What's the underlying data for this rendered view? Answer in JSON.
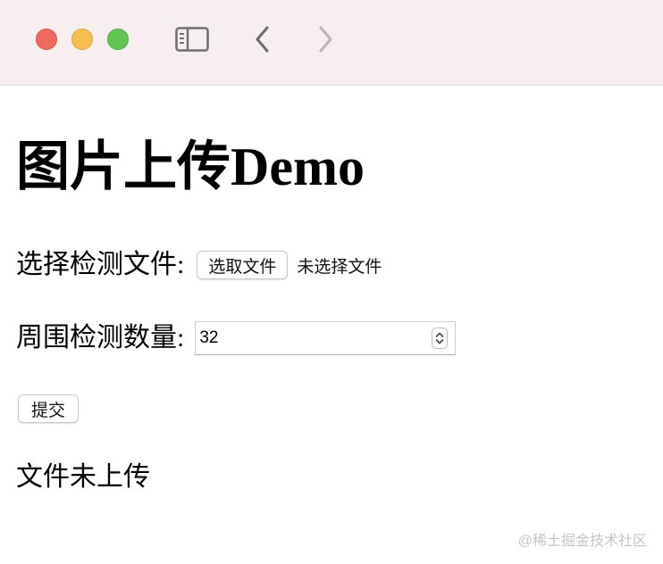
{
  "page": {
    "title": "图片上传Demo",
    "file_label": "选择检测文件:",
    "file_button_label": "选取文件",
    "file_status": "未选择文件",
    "count_label": "周围检测数量:",
    "count_value": "32",
    "submit_label": "提交",
    "upload_status": "文件未上传"
  },
  "watermark": {
    "text": "@稀土掘金技术社区"
  },
  "icons": {
    "sidebar": "sidebar-toggle-icon",
    "back": "chevron-left-icon",
    "forward": "chevron-right-icon"
  },
  "colors": {
    "titlebar": "#f7eeef",
    "close": "#ee6a5f",
    "minimize": "#f5be4f",
    "zoom": "#61c554"
  }
}
